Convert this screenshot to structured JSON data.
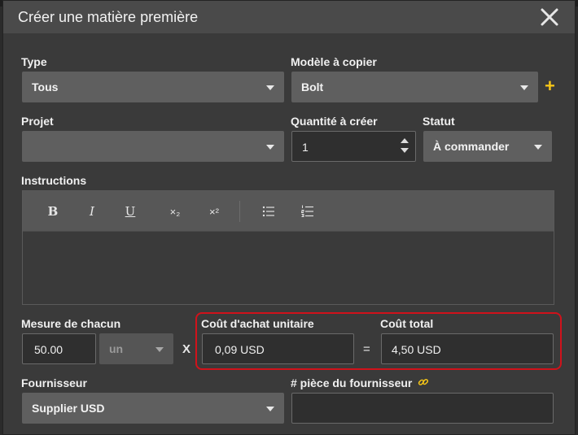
{
  "dialog": {
    "title": "Créer une matière première"
  },
  "form": {
    "type": {
      "label": "Type",
      "value": "Tous"
    },
    "model": {
      "label": "Modèle à copier",
      "value": "Bolt",
      "add_label": "+"
    },
    "project": {
      "label": "Projet",
      "value": ""
    },
    "quantity": {
      "label": "Quantité à créer",
      "value": "1"
    },
    "status": {
      "label": "Statut",
      "value": "À commander"
    },
    "instructions": {
      "label": "Instructions",
      "toolbar": {
        "bold": "B",
        "italic": "I",
        "underline": "U",
        "subscript": "×₂",
        "superscript": "×²"
      },
      "content": ""
    },
    "measure": {
      "label": "Mesure de chacun",
      "value": "50.00",
      "unit": "un"
    },
    "times_symbol": "X",
    "unit_cost": {
      "label": "Coût d'achat unitaire",
      "value": "0,09 USD"
    },
    "equals_symbol": "=",
    "total_cost": {
      "label": "Coût total",
      "value": "4,50 USD"
    },
    "supplier": {
      "label": "Fournisseur",
      "value": "Supplier USD"
    },
    "supplier_part": {
      "label": "# pièce du fournisseur",
      "value": ""
    }
  },
  "colors": {
    "accent_yellow": "#f5c518",
    "highlight_red": "#d0121b"
  }
}
